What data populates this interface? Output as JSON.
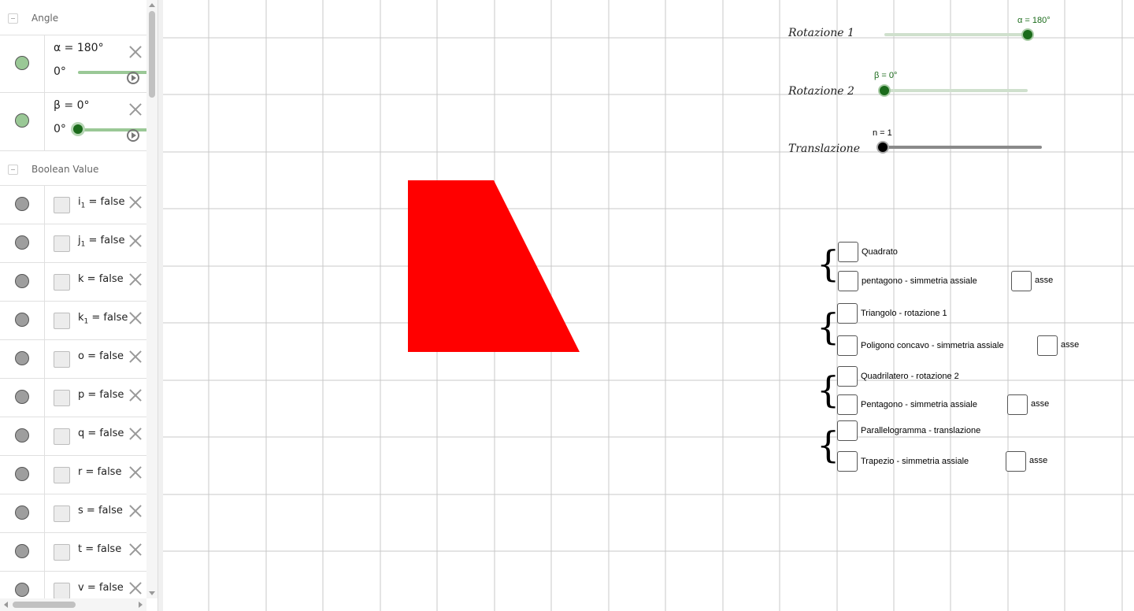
{
  "algebra": {
    "angle_group": {
      "title": "Angle"
    },
    "sliders": [
      {
        "expr": "α = 180°",
        "min_label": "0°",
        "value_fraction": 1.0,
        "marker_color": "#9ac896"
      },
      {
        "expr": "β = 0°",
        "min_label": "0°",
        "value_fraction": 0.0,
        "marker_color": "#9ac896"
      }
    ],
    "boolean_group": {
      "title": "Boolean Value"
    },
    "booleans": [
      {
        "name": "i",
        "sub": "1",
        "value": "= false"
      },
      {
        "name": "j",
        "sub": "1",
        "value": "= false"
      },
      {
        "name": "k",
        "sub": "",
        "value": "= false"
      },
      {
        "name": "k",
        "sub": "1",
        "value": "= false"
      },
      {
        "name": "o",
        "sub": "",
        "value": "= false"
      },
      {
        "name": "p",
        "sub": "",
        "value": "= false"
      },
      {
        "name": "q",
        "sub": "",
        "value": "= false"
      },
      {
        "name": "r",
        "sub": "",
        "value": "= false"
      },
      {
        "name": "s",
        "sub": "",
        "value": "= false"
      },
      {
        "name": "t",
        "sub": "",
        "value": "= false"
      },
      {
        "name": "v",
        "sub": "",
        "value": "= false"
      }
    ]
  },
  "graphics": {
    "sliders": [
      {
        "label": "Rotazione 1",
        "value_label": "α = 180°",
        "value_fraction": 1.0,
        "color": "#1b6b1b"
      },
      {
        "label": "Rotazione 2",
        "value_label": "β = 0°",
        "value_fraction": 0.0,
        "color": "#1b6b1b"
      },
      {
        "label": "Translazione",
        "value_label": "n = 1",
        "value_fraction": 0.0,
        "color": "#000000"
      }
    ],
    "checkboxes": [
      {
        "label": "Quadrato"
      },
      {
        "label": "pentagono - simmetria assiale",
        "axis": "asse"
      },
      {
        "label": "Triangolo - rotazione 1"
      },
      {
        "label": "Poligono concavo - simmetria assiale",
        "axis": "asse"
      },
      {
        "label": "Quadrilatero - rotazione 2"
      },
      {
        "label": "Pentagono - simmetria assiale",
        "axis": "asse"
      },
      {
        "label": "Parallelogramma - translazione"
      },
      {
        "label": "Trapezio - simmetria assiale",
        "axis": "asse"
      }
    ],
    "shape": {
      "name": "trapezio",
      "fill": "#ff0000"
    },
    "grid_color": "#c8c8c8"
  },
  "icons": [
    "collapse-icon",
    "close-icon",
    "play-icon",
    "visibility-dot-icon"
  ]
}
